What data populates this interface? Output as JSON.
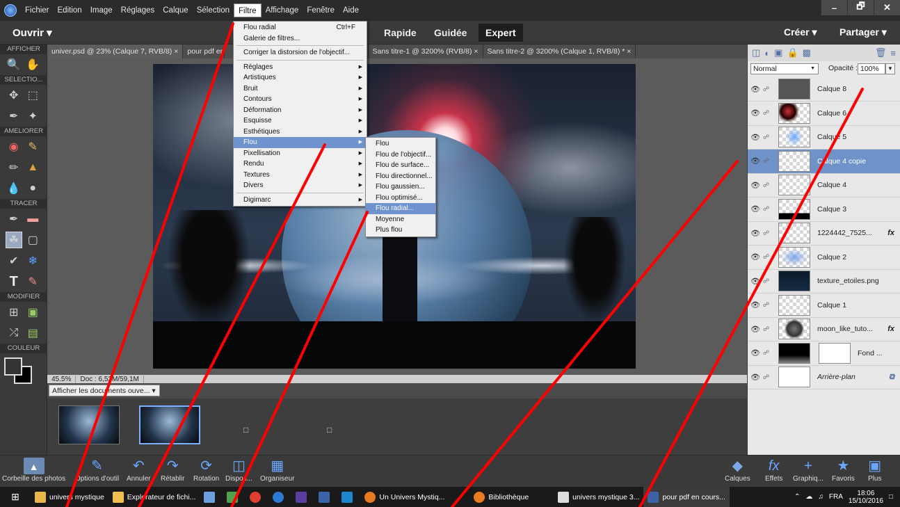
{
  "menubar": {
    "items": [
      "Fichier",
      "Edition",
      "Image",
      "Réglages",
      "Calque",
      "Sélection",
      "Filtre",
      "Affichage",
      "Fenêtre",
      "Aide"
    ],
    "active": "Filtre",
    "window_controls": [
      "–",
      "🗗",
      "✕"
    ]
  },
  "modebar": {
    "open": "Ouvrir ▾",
    "tabs": [
      "Rapide",
      "Guidée",
      "Expert"
    ],
    "selected_tab": "Expert",
    "create": "Créer ▾",
    "share": "Partager ▾"
  },
  "toolbox": {
    "sections": [
      "AFFICHER",
      "SELECTIO...",
      "AMELIORER",
      "TRACER",
      "MODIFIER",
      "COULEUR"
    ]
  },
  "doc_tabs": [
    "univer.psd @ 23% (Calque 7, RVB/8)  ×",
    "pour pdf en co",
    "*  ×",
    "Sans titre-1 @ 3200% (RVB/8)  ×",
    "Sans titre-2 @ 3200% (Calque 1, RVB/8) *  ×"
  ],
  "statusbar": {
    "zoom": "45.5%",
    "doc": "Doc : 6,52M/59,1M"
  },
  "docs_dropdown": "Afficher les documents ouve...  ▾",
  "filter_menu": {
    "items": [
      {
        "label": "Flou radial",
        "shortcut": "Ctrl+F"
      },
      {
        "label": "Galerie de filtres..."
      },
      {
        "sep": true
      },
      {
        "label": "Corriger la distorsion de l'objectif..."
      },
      {
        "sep": true
      },
      {
        "label": "Réglages",
        "sub": true
      },
      {
        "label": "Artistiques",
        "sub": true
      },
      {
        "label": "Bruit",
        "sub": true
      },
      {
        "label": "Contours",
        "sub": true
      },
      {
        "label": "Déformation",
        "sub": true
      },
      {
        "label": "Esquisse",
        "sub": true
      },
      {
        "label": "Esthétiques",
        "sub": true
      },
      {
        "label": "Flou",
        "sub": true,
        "highlight": true
      },
      {
        "label": "Pixellisation",
        "sub": true
      },
      {
        "label": "Rendu",
        "sub": true
      },
      {
        "label": "Textures",
        "sub": true
      },
      {
        "label": "Divers",
        "sub": true
      },
      {
        "sep": true
      },
      {
        "label": "Digimarc",
        "sub": true
      }
    ]
  },
  "blur_submenu": {
    "items": [
      "Flou",
      "Flou de l'objectif...",
      "Flou de surface...",
      "Flou directionnel...",
      "Flou gaussien...",
      "Flou optimisé...",
      "Flou radial...",
      "Moyenne",
      "Plus flou"
    ],
    "highlighted": "Flou radial..."
  },
  "layers": {
    "blend_mode": "Normal",
    "opacity_label": "Opacité :",
    "opacity": "100%",
    "rows": [
      {
        "name": "Calque 8"
      },
      {
        "name": "Calque 6"
      },
      {
        "name": "Calque 5"
      },
      {
        "name": "Calque 4 copie",
        "selected": true
      },
      {
        "name": "Calque 4"
      },
      {
        "name": "Calque 3"
      },
      {
        "name": "1224442_7525...",
        "fx": "fx"
      },
      {
        "name": "Calque 2"
      },
      {
        "name": "texture_etoiles.png"
      },
      {
        "name": "Calque 1"
      },
      {
        "name": "moon_like_tuto...",
        "fx": "fx"
      },
      {
        "name": "Fond ..."
      },
      {
        "name": "Arrière-plan"
      }
    ]
  },
  "bottombar": {
    "left": [
      "Corbeille des photos",
      "Options d'outil",
      "Annuler",
      "Rétablir",
      "Rotation",
      "Dispos...",
      "Organiseur"
    ],
    "right": [
      "Calques",
      "Effets",
      "Graphiq...",
      "Favoris",
      "Plus"
    ]
  },
  "taskbar": {
    "tasks": [
      "univers mystique",
      "Explorateur de fichi...",
      "",
      "",
      "",
      "",
      "",
      "",
      "",
      "Un Univers Mystiq...",
      "Bibliothèque",
      "univers mystique 3...",
      "pour pdf en cours..."
    ],
    "active": "pour pdf en cours...",
    "lang": "FRA",
    "time": "18:06",
    "date": "15/10/2016"
  },
  "colors": {
    "annotation": "#ff0000",
    "highlight": "#6e93cf",
    "layer_selected": "#6f93c8"
  }
}
